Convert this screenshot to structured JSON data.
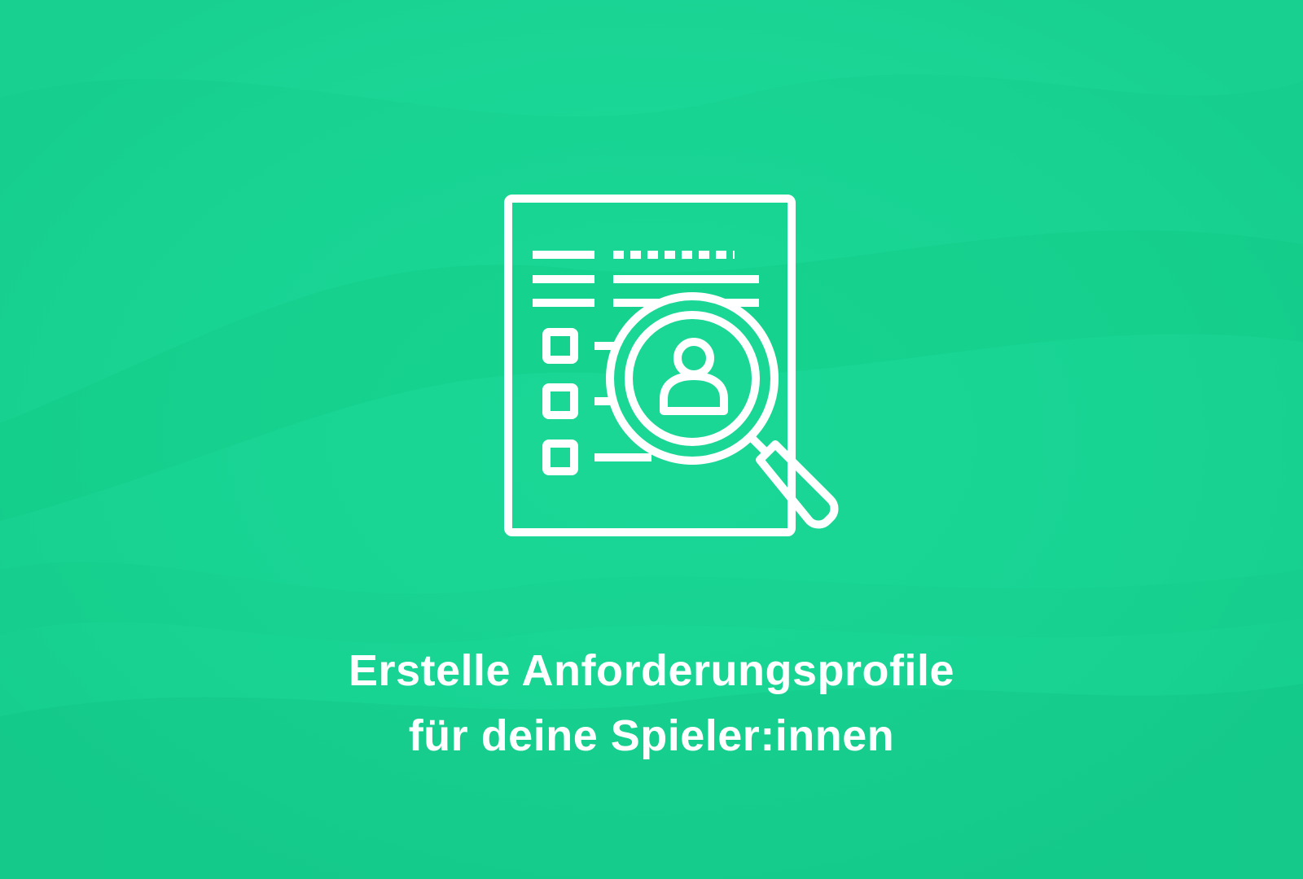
{
  "headline": {
    "line1": "Erstelle Anforderungsprofile",
    "line2": "für deine Spieler:innen"
  },
  "illustration": {
    "icon": "document-search-profile-icon"
  },
  "colors": {
    "background": "#1ad796",
    "background_dark": "#10be80",
    "foreground": "#ffffff"
  }
}
